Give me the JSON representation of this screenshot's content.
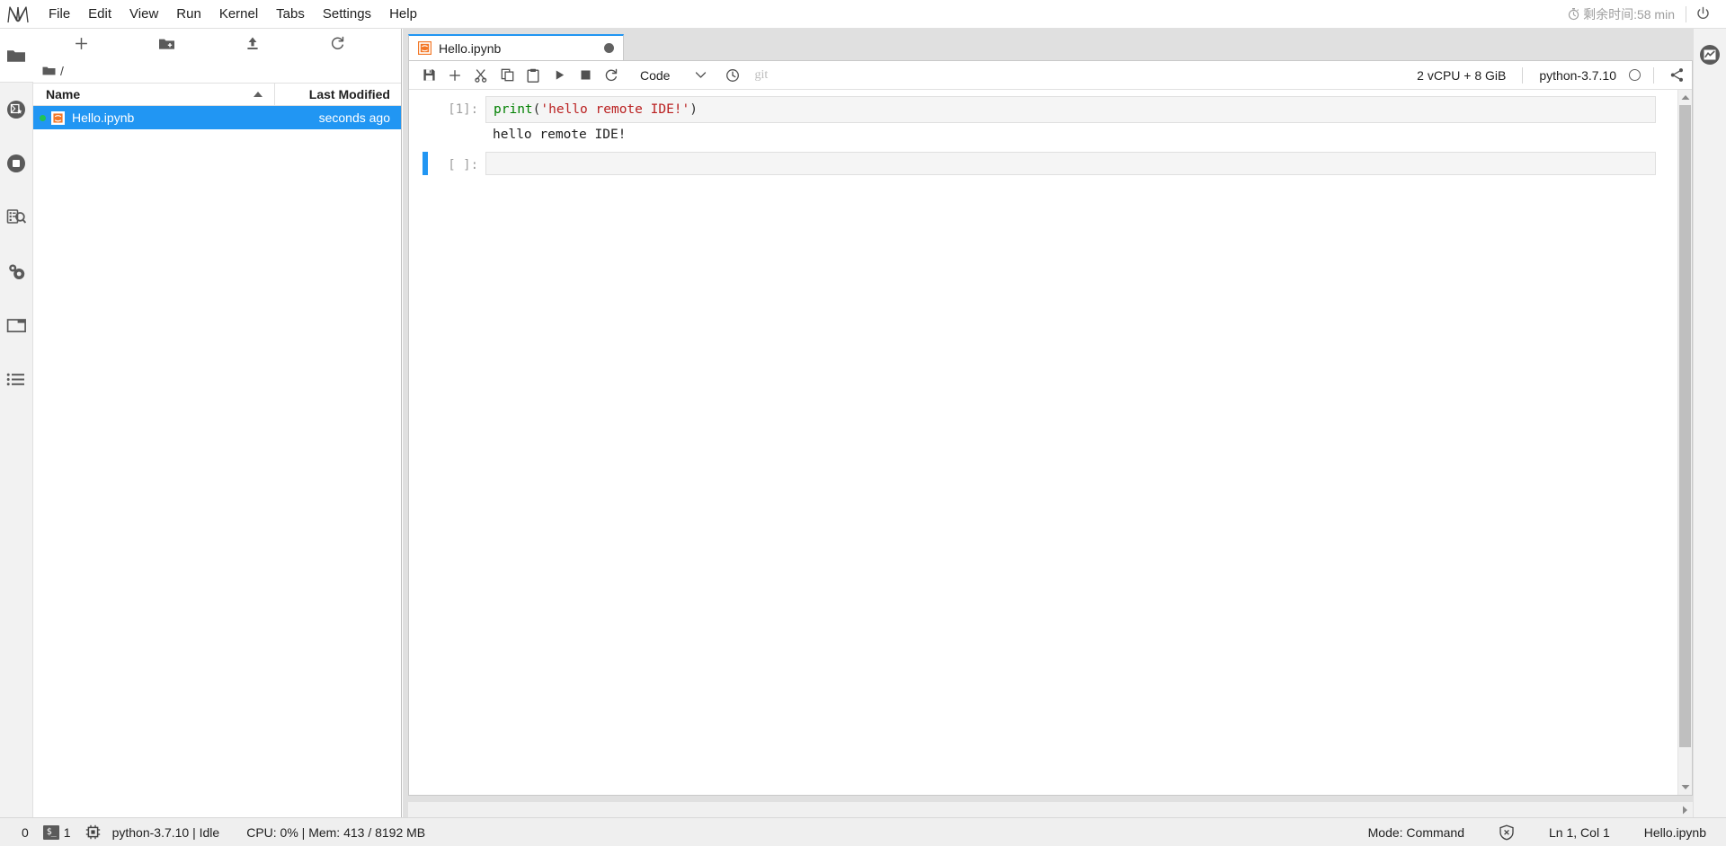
{
  "menubar": {
    "logo": "jupyter-logo",
    "items": [
      {
        "label": "File"
      },
      {
        "label": "Edit"
      },
      {
        "label": "View"
      },
      {
        "label": "Run"
      },
      {
        "label": "Kernel"
      },
      {
        "label": "Tabs"
      },
      {
        "label": "Settings"
      },
      {
        "label": "Help"
      }
    ],
    "timer_text": "剩余时间:58 min",
    "timer_icon": "stopwatch-icon",
    "power_icon": "power-icon"
  },
  "left_sidebar": {
    "items": [
      {
        "name": "file-browser",
        "icon": "folder-icon",
        "active": true
      },
      {
        "name": "running-sessions",
        "icon": "badge-star-icon"
      },
      {
        "name": "kernel-stop",
        "icon": "stop-circle-icon"
      },
      {
        "name": "git-panel",
        "icon": "document-search-icon"
      },
      {
        "name": "extension-manager",
        "icon": "gears-icon"
      },
      {
        "name": "tab-manager",
        "icon": "window-icon"
      },
      {
        "name": "table-of-contents",
        "icon": "list-icon"
      }
    ]
  },
  "right_sidebar": {
    "items": [
      {
        "name": "resource-monitor",
        "icon": "chart-circle-icon"
      }
    ]
  },
  "filebrowser": {
    "toolbar": [
      {
        "name": "new-launcher",
        "icon": "plus-icon",
        "title": "New Launcher"
      },
      {
        "name": "new-folder",
        "icon": "new-folder-icon",
        "title": "New Folder"
      },
      {
        "name": "upload-files",
        "icon": "upload-icon",
        "title": "Upload Files"
      },
      {
        "name": "refresh",
        "icon": "refresh-icon",
        "title": "Refresh File List"
      }
    ],
    "breadcrumb": "/",
    "breadcrumb_icon": "folder-icon",
    "columns": {
      "name": "Name",
      "last_modified": "Last Modified",
      "sort_direction": "ascending"
    },
    "rows": [
      {
        "name": "Hello.ipynb",
        "last_modified": "seconds ago",
        "icon": "notebook-icon",
        "running": true,
        "selected": true
      }
    ]
  },
  "dock": {
    "tabs": [
      {
        "label": "Hello.ipynb",
        "icon": "notebook-icon",
        "dirty": true,
        "active": true
      }
    ]
  },
  "notebook": {
    "toolbar": {
      "buttons": [
        {
          "name": "save-notebook",
          "icon": "save-icon"
        },
        {
          "name": "insert-cell",
          "icon": "plus-icon"
        },
        {
          "name": "cut-cells",
          "icon": "scissors-icon"
        },
        {
          "name": "copy-cells",
          "icon": "copy-icon"
        },
        {
          "name": "paste-cells",
          "icon": "paste-icon"
        },
        {
          "name": "run-cell",
          "icon": "play-icon"
        },
        {
          "name": "interrupt-kernel",
          "icon": "stop-square-icon"
        },
        {
          "name": "restart-kernel",
          "icon": "restart-icon"
        }
      ],
      "cell_type": "Code",
      "cell_type_caret": "chevron-down-icon",
      "history_icon": "clock-icon",
      "git_label": "git",
      "resources": "2 vCPU + 8 GiB",
      "kernel_name": "python-3.7.10",
      "kernel_status": "idle",
      "share_icon": "share-icon"
    },
    "cells": [
      {
        "prompt": "[1]:",
        "selected": false,
        "source_tokens": [
          {
            "text": "print",
            "type": "fn"
          },
          {
            "text": "(",
            "type": "paren"
          },
          {
            "text": "'hello remote IDE!'",
            "type": "str"
          },
          {
            "text": ")",
            "type": "paren"
          }
        ],
        "source_plain": "print('hello remote IDE!')",
        "output": "hello remote IDE!"
      },
      {
        "prompt": "[ ]:",
        "selected": true,
        "source_plain": "",
        "output": null
      }
    ],
    "scrollbar": {
      "up_arrow": "triangle-up-icon",
      "down_arrow": "triangle-down-icon"
    }
  },
  "statusbar": {
    "left": [
      {
        "name": "kernel-count",
        "value": "0",
        "icon": null
      },
      {
        "name": "terminal-count",
        "value": "1",
        "icon": "terminal-icon"
      },
      {
        "name": "kernel-state",
        "value": "python-3.7.10 | Idle",
        "icon": "cpu-chip-icon"
      },
      {
        "name": "resource-usage",
        "value": "CPU: 0% | Mem: 413 / 8192 MB",
        "icon": null
      }
    ],
    "right": [
      {
        "name": "editor-mode",
        "value": "Mode: Command"
      },
      {
        "name": "diagnostics",
        "value": "",
        "icon": "shield-x-icon"
      },
      {
        "name": "cursor-position",
        "value": "Ln 1, Col 1"
      },
      {
        "name": "active-file",
        "value": "Hello.ipynb"
      }
    ]
  },
  "colors": {
    "accent_blue": "#2196f3",
    "selection_blue": "#2196f3",
    "running_green": "#21c354",
    "string_red": "#ba2121",
    "keyword_green": "#008000",
    "panel_gray": "#e0e0e0"
  }
}
